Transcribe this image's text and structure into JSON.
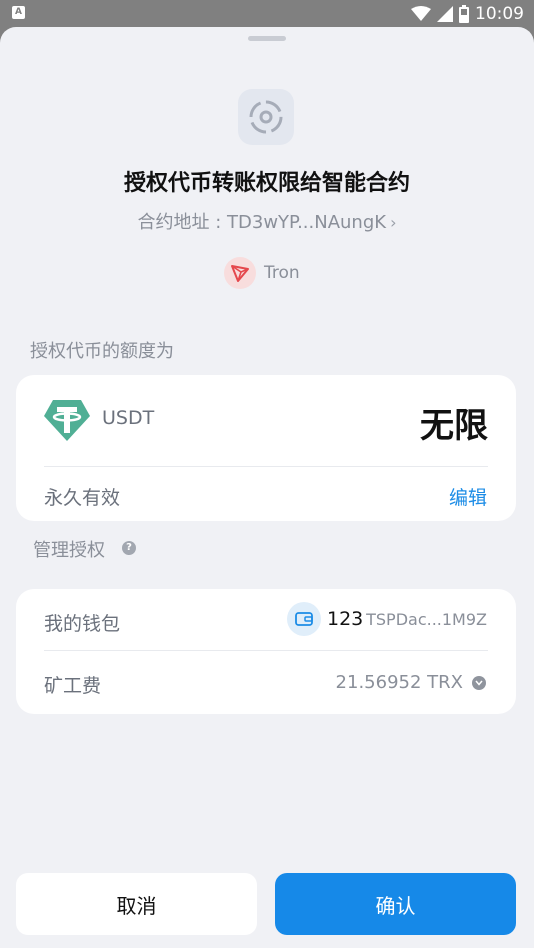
{
  "status_bar": {
    "time": "10:09",
    "app_icon_letter": "A"
  },
  "header": {
    "title": "授权代币转账权限给智能合约",
    "contract_address": "合约地址 : TD3wYP...NAungK",
    "chain": "Tron"
  },
  "allowance": {
    "section_label": "授权代币的额度为",
    "token": "USDT",
    "amount": "无限",
    "validity": "永久有效",
    "edit_label": "编辑"
  },
  "manage": {
    "section_label": "管理授权",
    "wallet_label": "我的钱包",
    "wallet_name": "123",
    "wallet_address": "TSPDac...1M9Z",
    "fee_label": "矿工费",
    "fee_value": "21.56952 TRX"
  },
  "buttons": {
    "cancel": "取消",
    "confirm": "确认"
  },
  "colors": {
    "accent": "#1689e8",
    "tron_red": "#e5484d",
    "usdt_green": "#50af95"
  }
}
